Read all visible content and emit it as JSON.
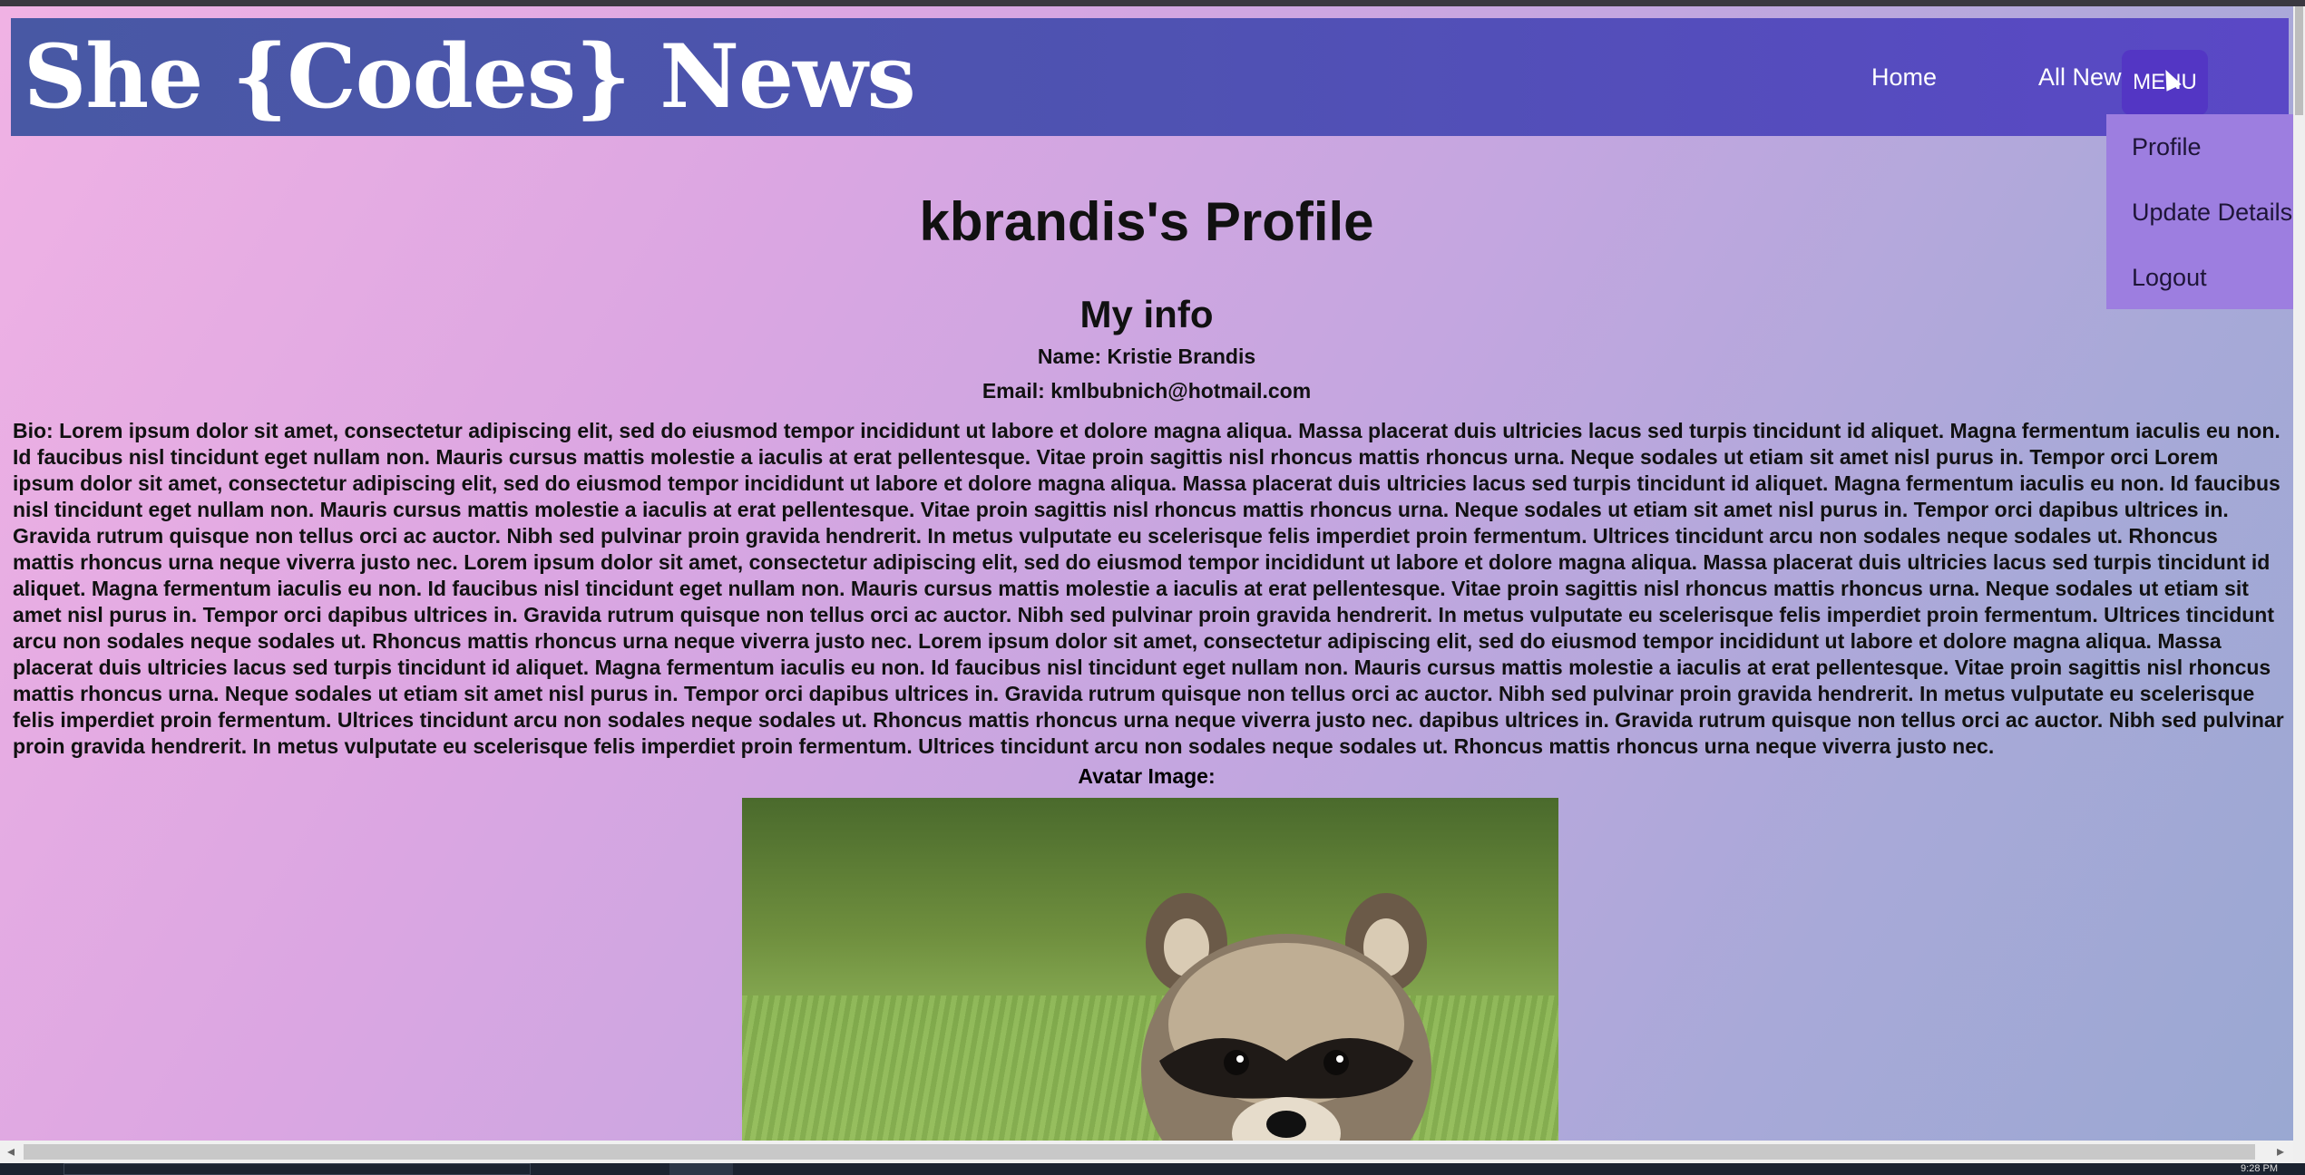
{
  "navbar": {
    "logo": "She {Codes} News",
    "links": {
      "home": "Home",
      "all_news": "All News"
    },
    "menu_label": "MENU"
  },
  "dropdown": {
    "items": [
      "Profile",
      "Update Details",
      "Logout"
    ]
  },
  "profile": {
    "title": "kbrandis's Profile",
    "section_title": "My info",
    "name_line": "Name: Kristie Brandis",
    "email_line": "Email: kmlbubnich@hotmail.com",
    "bio": "Bio: Lorem ipsum dolor sit amet, consectetur adipiscing elit, sed do eiusmod tempor incididunt ut labore et dolore magna aliqua. Massa placerat duis ultricies lacus sed turpis tincidunt id aliquet. Magna fermentum iaculis eu non. Id faucibus nisl tincidunt eget nullam non. Mauris cursus mattis molestie a iaculis at erat pellentesque. Vitae proin sagittis nisl rhoncus mattis rhoncus urna. Neque sodales ut etiam sit amet nisl purus in. Tempor orci Lorem ipsum dolor sit amet, consectetur adipiscing elit, sed do eiusmod tempor incididunt ut labore et dolore magna aliqua. Massa placerat duis ultricies lacus sed turpis tincidunt id aliquet. Magna fermentum iaculis eu non. Id faucibus nisl tincidunt eget nullam non. Mauris cursus mattis molestie a iaculis at erat pellentesque. Vitae proin sagittis nisl rhoncus mattis rhoncus urna. Neque sodales ut etiam sit amet nisl purus in. Tempor orci dapibus ultrices in. Gravida rutrum quisque non tellus orci ac auctor. Nibh sed pulvinar proin gravida hendrerit. In metus vulputate eu scelerisque felis imperdiet proin fermentum. Ultrices tincidunt arcu non sodales neque sodales ut. Rhoncus mattis rhoncus urna neque viverra justo nec. Lorem ipsum dolor sit amet, consectetur adipiscing elit, sed do eiusmod tempor incididunt ut labore et dolore magna aliqua. Massa placerat duis ultricies lacus sed turpis tincidunt id aliquet. Magna fermentum iaculis eu non. Id faucibus nisl tincidunt eget nullam non. Mauris cursus mattis molestie a iaculis at erat pellentesque. Vitae proin sagittis nisl rhoncus mattis rhoncus urna. Neque sodales ut etiam sit amet nisl purus in. Tempor orci dapibus ultrices in. Gravida rutrum quisque non tellus orci ac auctor. Nibh sed pulvinar proin gravida hendrerit. In metus vulputate eu scelerisque felis imperdiet proin fermentum. Ultrices tincidunt arcu non sodales neque sodales ut. Rhoncus mattis rhoncus urna neque viverra justo nec. Lorem ipsum dolor sit amet, consectetur adipiscing elit, sed do eiusmod tempor incididunt ut labore et dolore magna aliqua. Massa placerat duis ultricies lacus sed turpis tincidunt id aliquet. Magna fermentum iaculis eu non. Id faucibus nisl tincidunt eget nullam non. Mauris cursus mattis molestie a iaculis at erat pellentesque. Vitae proin sagittis nisl rhoncus mattis rhoncus urna. Neque sodales ut etiam sit amet nisl purus in. Tempor orci dapibus ultrices in. Gravida rutrum quisque non tellus orci ac auctor. Nibh sed pulvinar proin gravida hendrerit. In metus vulputate eu scelerisque felis imperdiet proin fermentum. Ultrices tincidunt arcu non sodales neque sodales ut. Rhoncus mattis rhoncus urna neque viverra justo nec. dapibus ultrices in. Gravida rutrum quisque non tellus orci ac auctor. Nibh sed pulvinar proin gravida hendrerit. In metus vulputate eu scelerisque felis imperdiet proin fermentum. Ultrices tincidunt arcu non sodales neque sodales ut. Rhoncus mattis rhoncus urna neque viverra justo nec.",
    "avatar_label": "Avatar Image:"
  },
  "taskbar": {
    "clock": "9:28 PM"
  }
}
